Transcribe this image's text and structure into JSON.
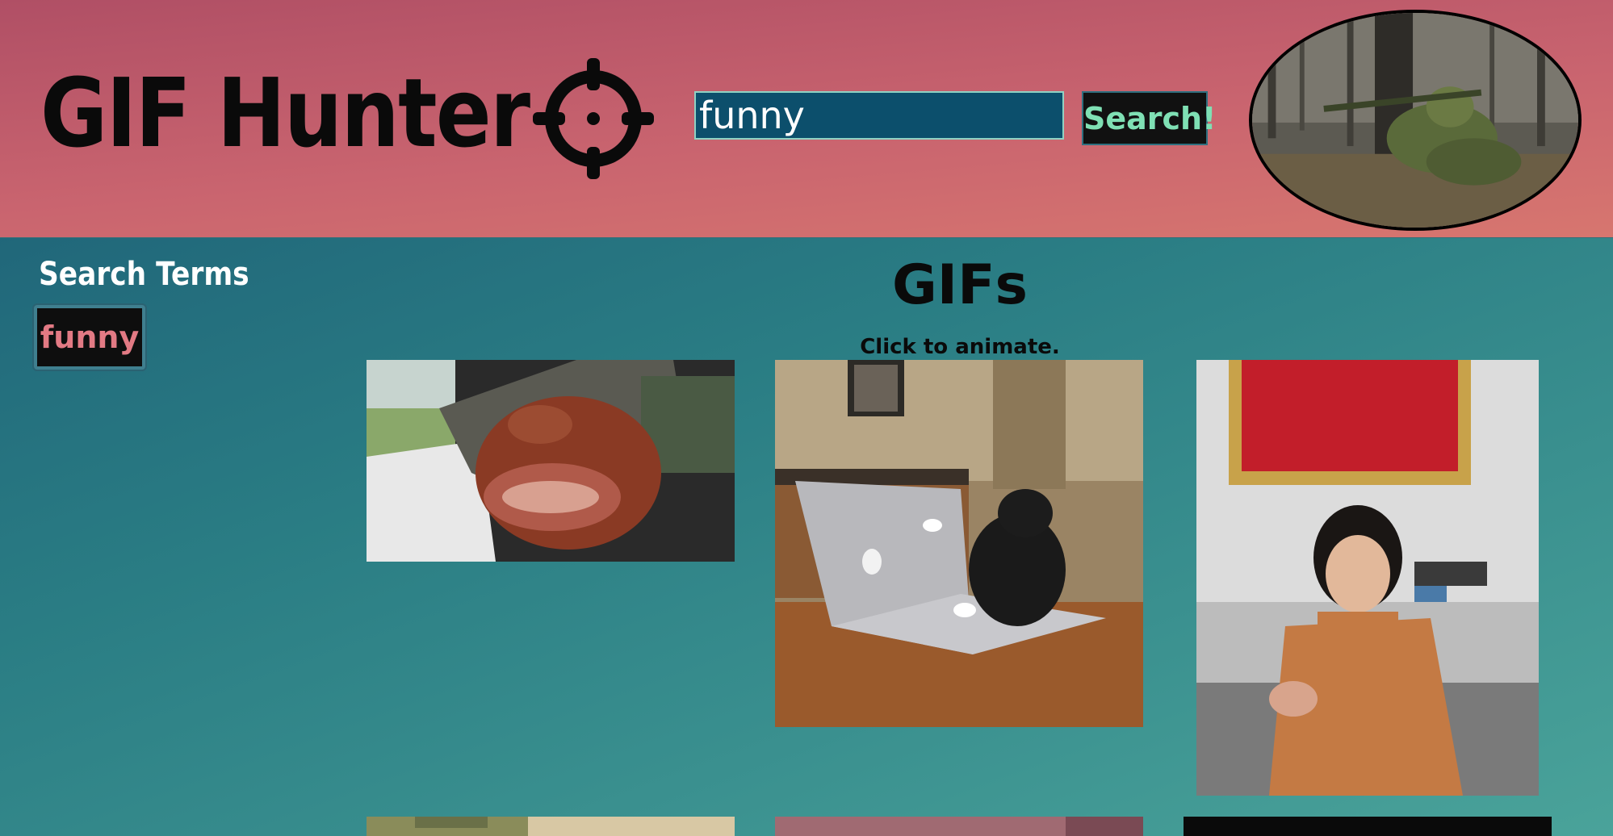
{
  "header": {
    "title": "GIF Hunter",
    "search": {
      "value": "funny",
      "placeholder": ""
    },
    "search_button_label": "Search!"
  },
  "sidebar": {
    "title": "Search Terms",
    "terms": [
      {
        "label": "funny"
      }
    ]
  },
  "gifs": {
    "heading": "GIFs",
    "subtitle": "Click to animate.",
    "items": [
      {
        "subject": "dog in car window"
      },
      {
        "subject": "cat typing on laptop"
      },
      {
        "subject": "woman sitting"
      },
      {
        "subject": "gif"
      },
      {
        "subject": "gif"
      },
      {
        "subject": "gif"
      }
    ]
  },
  "colors": {
    "header_gradient": [
      "#b04f65",
      "#d7766f"
    ],
    "body_gradient": [
      "#1b5a74",
      "#4aa39a"
    ],
    "search_input_bg": "#0c4f6c",
    "search_button_text": "#7fe0b4",
    "term_button_text": "#e27a84"
  },
  "icons": {
    "logo": "crosshair-icon"
  }
}
